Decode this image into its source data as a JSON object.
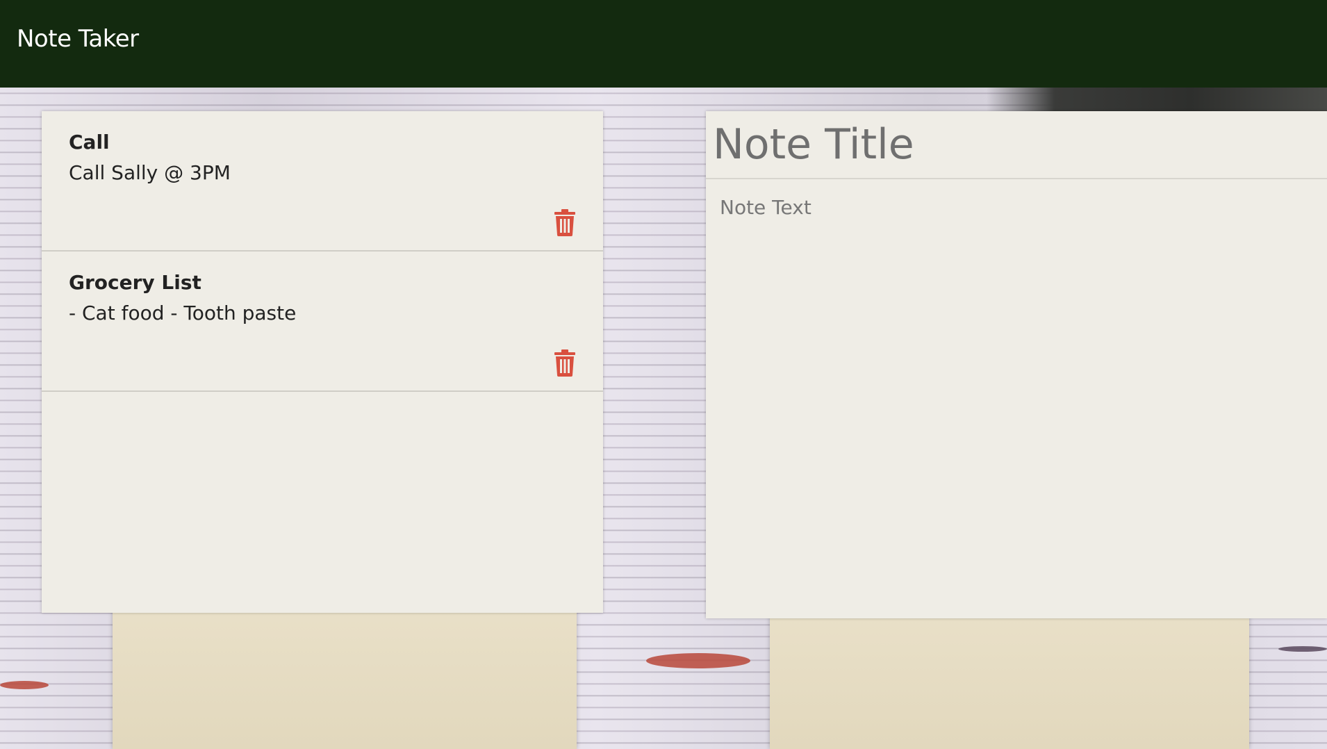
{
  "app": {
    "brand": "Note Taker"
  },
  "notes": [
    {
      "title": "Call",
      "text": "Call Sally @ 3PM"
    },
    {
      "title": "Grocery List",
      "text": "- Cat food - Tooth paste"
    }
  ],
  "editor": {
    "title_placeholder": "Note Title",
    "text_placeholder": "Note Text"
  },
  "colors": {
    "navbar": "#132a0f",
    "panel": "#efede6",
    "delete_icon": "#d9503f"
  },
  "icons": {
    "delete": "trash-icon"
  }
}
